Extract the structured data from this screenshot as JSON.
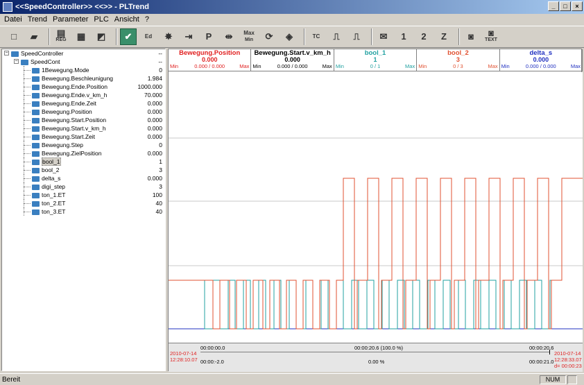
{
  "window": {
    "title": "<<SpeedController>> <<>> - PLTrend"
  },
  "menu": [
    "Datei",
    "Trend",
    "Parameter",
    "PLC",
    "Ansicht",
    "?"
  ],
  "toolbar": {
    "buttons": [
      {
        "name": "new-icon",
        "glyph": "□",
        "label": ""
      },
      {
        "name": "open-icon",
        "glyph": "▰",
        "label": ""
      },
      {
        "name": "save-reg-icon",
        "glyph": "▤",
        "label": "REG"
      },
      {
        "name": "grid-icon",
        "glyph": "▦",
        "label": ""
      },
      {
        "name": "chart-icon",
        "glyph": "◩",
        "label": ""
      },
      {
        "name": "check-trend-icon",
        "glyph": "✔",
        "label": ""
      },
      {
        "name": "ed-trend-icon",
        "glyph": "Ed",
        "label": ""
      },
      {
        "name": "burst-icon",
        "glyph": "✸",
        "label": ""
      },
      {
        "name": "export-icon",
        "glyph": "⇥",
        "label": ""
      },
      {
        "name": "flag-icon",
        "glyph": "P",
        "label": ""
      },
      {
        "name": "align-icon",
        "glyph": "⇹",
        "label": ""
      },
      {
        "name": "maxmin-icon",
        "glyph": "Max",
        "label": "Min"
      },
      {
        "name": "rotate-icon",
        "glyph": "⟳",
        "label": ""
      },
      {
        "name": "cube-icon",
        "glyph": "◈",
        "label": ""
      },
      {
        "name": "tc-icon",
        "glyph": "TC",
        "label": ""
      },
      {
        "name": "pulse1-icon",
        "glyph": "⎍",
        "label": ""
      },
      {
        "name": "pulse2-icon",
        "glyph": "⎍",
        "label": ""
      },
      {
        "name": "envelope-icon",
        "glyph": "✉",
        "label": ""
      },
      {
        "name": "scale1-icon",
        "glyph": "1",
        "label": ""
      },
      {
        "name": "scale2-icon",
        "glyph": "2",
        "label": ""
      },
      {
        "name": "scale-z-icon",
        "glyph": "Z",
        "label": ""
      },
      {
        "name": "camera-icon",
        "glyph": "◙",
        "label": ""
      },
      {
        "name": "camera-text-icon",
        "glyph": "◙",
        "label": "TEXT"
      }
    ]
  },
  "tree": {
    "root": "SpeedController",
    "root_value": "--",
    "child": "SpeedCont",
    "child_value": "--",
    "items": [
      {
        "label": "1Bewegung.Mode",
        "value": "0"
      },
      {
        "label": "Bewegung.Beschleunigung",
        "value": "1.984"
      },
      {
        "label": "Bewegung.Ende.Position",
        "value": "1000.000"
      },
      {
        "label": "Bewegung.Ende.v_km_h",
        "value": "70.000"
      },
      {
        "label": "Bewegung.Ende.Zeit",
        "value": "0.000"
      },
      {
        "label": "Bewegung.Position",
        "value": "0.000"
      },
      {
        "label": "Bewegung.Start.Position",
        "value": "0.000"
      },
      {
        "label": "Bewegung.Start.v_km_h",
        "value": "0.000"
      },
      {
        "label": "Bewegung.Start.Zeit",
        "value": "0.000"
      },
      {
        "label": "Bewegung.Step",
        "value": "0"
      },
      {
        "label": "Bewegung.ZielPosition",
        "value": "0.000"
      },
      {
        "label": "bool_1",
        "value": "1",
        "selected": true
      },
      {
        "label": "bool_2",
        "value": "3"
      },
      {
        "label": "delta_s",
        "value": "0.000"
      },
      {
        "label": "digi_step",
        "value": "3"
      },
      {
        "label": "ton_1.ET",
        "value": "100"
      },
      {
        "label": "ton_2.ET",
        "value": "40"
      },
      {
        "label": "ton_3.ET",
        "value": "40"
      }
    ]
  },
  "channels": [
    {
      "name": "Bewegung.Position",
      "value": "0.000",
      "color": "#e02020",
      "min": "Min",
      "max": "Max",
      "range": "0.000 / 0.000"
    },
    {
      "name": "Bewegung.Start.v_km_h",
      "value": "0.000",
      "color": "#000000",
      "min": "Min",
      "max": "Max",
      "range": "0.000 / 0.000"
    },
    {
      "name": "bool_1",
      "value": "1",
      "color": "#20a0a0",
      "min": "Min",
      "max": "Max",
      "range": "0 /   1"
    },
    {
      "name": "bool_2",
      "value": "3",
      "color": "#e05030",
      "min": "Min",
      "max": "Max",
      "range": "0 /   3"
    },
    {
      "name": "delta_s",
      "value": "0.000",
      "color": "#2030c0",
      "min": "Min",
      "max": "Max",
      "range": "0.000 / 0.000"
    }
  ],
  "timebar": {
    "start_date": "2010-07-14",
    "start_time": "12:28:10.07",
    "t0": "00:00:00.0",
    "t_offset": "00:00:-2.0",
    "t_mid": "00:00:20.6 (100.0 %)",
    "percent": "0.00 %",
    "t_end": "00:00:20.6",
    "t_end2": "00:00:21.0",
    "end_date": "2010-07-14",
    "end_time": "12:28:33.07",
    "delta": "d= 00:00:23"
  },
  "colors": {
    "bool_1": "#20a0a0",
    "bool_2": "#e05030",
    "delta_s": "#2030c0",
    "grid": "#c8c8c8"
  },
  "status": {
    "left": "Bereit",
    "num": "NUM"
  }
}
